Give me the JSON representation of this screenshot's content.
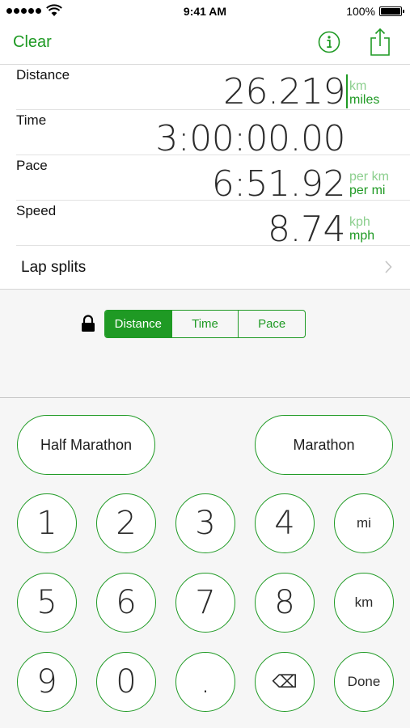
{
  "status_bar": {
    "time": "9:41 AM",
    "battery_percent": "100%"
  },
  "nav": {
    "clear_label": "Clear",
    "info_icon": "info-circle-icon",
    "share_icon": "share-icon"
  },
  "rows": {
    "distance": {
      "label": "Distance",
      "value": "26.219",
      "unit_inactive": "km",
      "unit_active": "miles"
    },
    "time": {
      "label": "Time",
      "value": "3:00:00.00"
    },
    "pace": {
      "label": "Pace",
      "value": "6:51.92",
      "unit_inactive": "per km",
      "unit_active": "per mi"
    },
    "speed": {
      "label": "Speed",
      "value": "8.74",
      "unit_inactive": "kph",
      "unit_active": "mph"
    }
  },
  "lap_splits": {
    "label": "Lap splits"
  },
  "lock": {
    "selected": "Distance",
    "segments": [
      "Distance",
      "Time",
      "Pace"
    ]
  },
  "keypad": {
    "half_marathon": "Half Marathon",
    "marathon": "Marathon",
    "keys": {
      "k1": "1",
      "k2": "2",
      "k3": "3",
      "k4": "4",
      "mi": "mi",
      "k5": "5",
      "k6": "6",
      "k7": "7",
      "k8": "8",
      "km": "km",
      "k9": "9",
      "k0": "0",
      "dot": ".",
      "backspace": "⌫",
      "done": "Done"
    }
  },
  "colors": {
    "accent": "#1f9a24",
    "accent_light": "#8ccf8e",
    "background_gray": "#f6f6f6"
  }
}
